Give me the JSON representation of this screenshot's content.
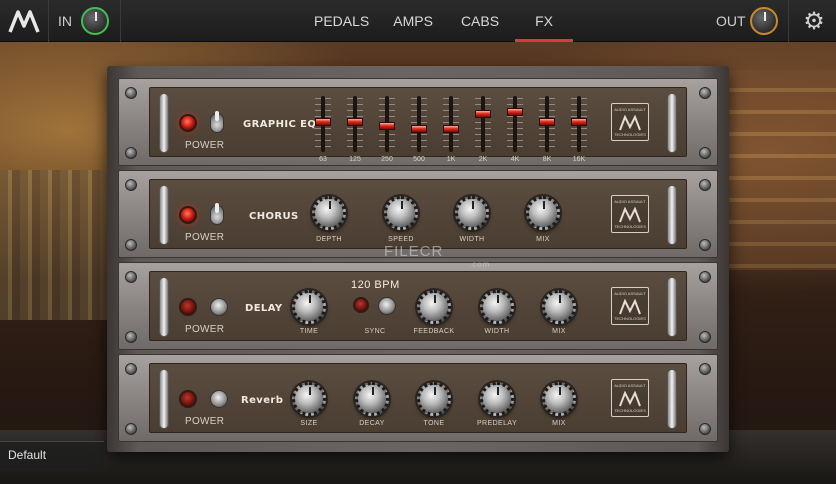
{
  "topbar": {
    "in_label": "IN",
    "out_label": "OUT",
    "tabs": [
      {
        "label": "PEDALS",
        "active": false
      },
      {
        "label": "AMPS",
        "active": false
      },
      {
        "label": "CABS",
        "active": false
      },
      {
        "label": "FX",
        "active": true
      }
    ],
    "accent_color": "#d93a3a",
    "in_knob_color": "#3fbf55",
    "out_knob_color": "#c98a2a",
    "settings_icon": "gear-icon"
  },
  "units": {
    "eq": {
      "title": "GRAPHIC EQ",
      "power_label": "POWER",
      "power_on": true,
      "bands": [
        {
          "label": "63",
          "level": 0.55
        },
        {
          "label": "125",
          "level": 0.55
        },
        {
          "label": "250",
          "level": 0.45
        },
        {
          "label": "500",
          "level": 0.4
        },
        {
          "label": "1K",
          "level": 0.4
        },
        {
          "label": "2K",
          "level": 0.7
        },
        {
          "label": "4K",
          "level": 0.75
        },
        {
          "label": "8K",
          "level": 0.55
        },
        {
          "label": "16K",
          "level": 0.55
        }
      ]
    },
    "chorus": {
      "title": "CHORUS",
      "power_label": "POWER",
      "power_on": true,
      "knobs": [
        "DEPTH",
        "SPEED",
        "WIDTH",
        "MIX"
      ]
    },
    "delay": {
      "title": "DELAY",
      "power_label": "POWER",
      "power_on": false,
      "bpm": "120 BPM",
      "time_label": "TIME",
      "sync_label": "SYNC",
      "knobs": [
        "FEEDBACK",
        "WIDTH",
        "MIX"
      ]
    },
    "reverb": {
      "title": "Reverb",
      "power_label": "POWER",
      "power_on": false,
      "knobs": [
        "SIZE",
        "DECAY",
        "TONE",
        "PREDELAY",
        "MIX"
      ]
    },
    "badge_top": "AUDIO ASSAULT",
    "badge_bottom": "TECHNOLOGIES"
  },
  "watermark": {
    "text": "FILECR",
    "suffix": ".com"
  },
  "preset": {
    "name": "Default"
  }
}
